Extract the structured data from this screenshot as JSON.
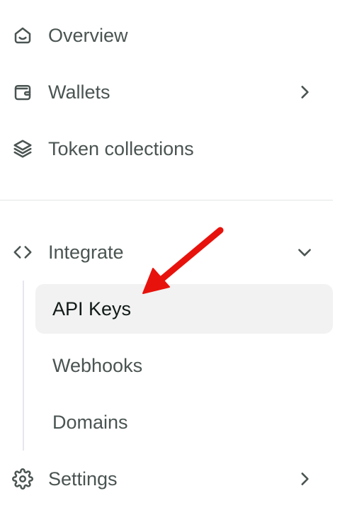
{
  "sidebar": {
    "items": [
      {
        "label": "Overview",
        "icon": "home-icon"
      },
      {
        "label": "Wallets",
        "icon": "wallet-icon",
        "chevron": "chevron-right-icon"
      },
      {
        "label": "Token collections",
        "icon": "layers-icon"
      }
    ],
    "integrate": {
      "label": "Integrate",
      "icon": "code-icon",
      "chevron": "chevron-down-icon",
      "expanded": true,
      "subitems": [
        {
          "label": "API Keys",
          "active": true
        },
        {
          "label": "Webhooks",
          "active": false
        },
        {
          "label": "Domains",
          "active": false
        }
      ]
    },
    "settings": {
      "label": "Settings",
      "icon": "gear-icon",
      "chevron": "chevron-right-icon"
    }
  },
  "colors": {
    "text": "#4a5452",
    "active_text": "#111a18",
    "active_background": "#f1f2f1",
    "divider": "#e3e6e5",
    "annotation_arrow": "#e8120c"
  }
}
